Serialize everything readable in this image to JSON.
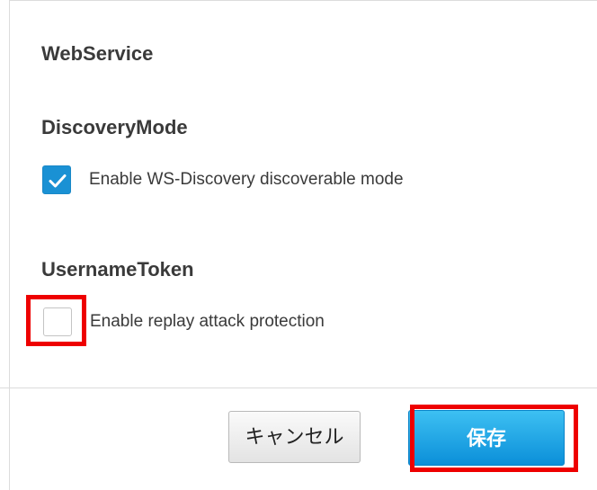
{
  "sections": {
    "webservice_title": "WebService",
    "discovery": {
      "title": "DiscoveryMode",
      "checkbox_label": "Enable WS-Discovery discoverable mode",
      "checked": true
    },
    "username_token": {
      "title": "UsernameToken",
      "checkbox_label": "Enable replay attack protection",
      "checked": false
    }
  },
  "buttons": {
    "cancel_label": "キャンセル",
    "save_label": "保存"
  },
  "colors": {
    "accent": "#1a91d4",
    "highlight": "#ee0000",
    "save_button_top": "#3dc0f2",
    "save_button_bottom": "#0b8fd9"
  },
  "icons": {
    "discovery_checkbox": "checkmark-icon"
  }
}
